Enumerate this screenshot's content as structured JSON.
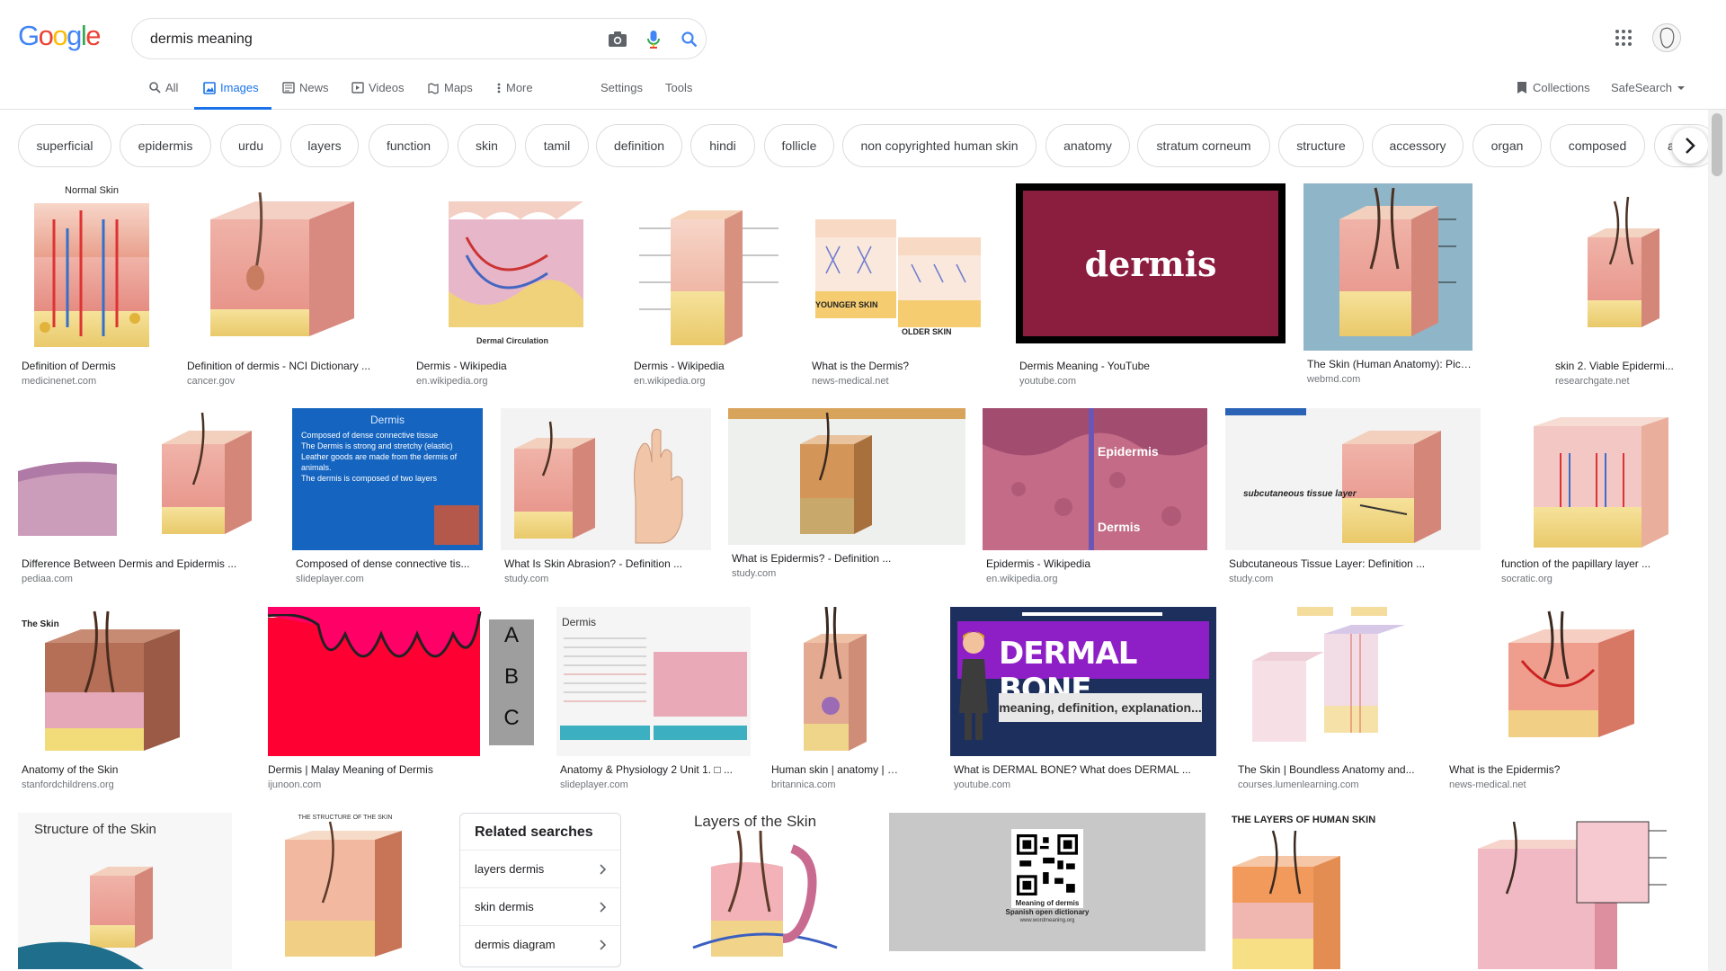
{
  "logo": "Google",
  "search": {
    "value": "dermis meaning"
  },
  "tabs": [
    {
      "label": "All"
    },
    {
      "label": "Images"
    },
    {
      "label": "News"
    },
    {
      "label": "Videos"
    },
    {
      "label": "Maps"
    },
    {
      "label": "More"
    }
  ],
  "settings_label": "Settings",
  "tools_label": "Tools",
  "collections_label": "Collections",
  "safesearch_label": "SafeSearch",
  "chips": [
    "superficial",
    "epidermis",
    "urdu",
    "layers",
    "function",
    "skin",
    "tamil",
    "definition",
    "hindi",
    "follicle",
    "non copyrighted human skin",
    "anatomy",
    "stratum corneum",
    "structure",
    "accessory",
    "organ",
    "composed",
    "a"
  ],
  "results": [
    {
      "title": "Definition of Dermis",
      "source": "medicinenet.com",
      "label": "Normal Skin"
    },
    {
      "title": "Definition of dermis - NCI Dictionary ...",
      "source": "cancer.gov"
    },
    {
      "title": "Dermis - Wikipedia",
      "source": "en.wikipedia.org",
      "label": "Dermal Circulation"
    },
    {
      "title": "Dermis - Wikipedia",
      "source": "en.wikipedia.org"
    },
    {
      "title": "What is the Dermis?",
      "source": "news-medical.net",
      "label": "YOUNGER SKIN",
      "label2": "OLDER SKIN"
    },
    {
      "title": "Dermis Meaning - YouTube",
      "source": "youtube.com",
      "label": "dermis"
    },
    {
      "title": "The Skin (Human Anatomy): Picture ...",
      "source": "webmd.com"
    },
    {
      "title": "skin 2. Viable Epidermi...",
      "source": "researchgate.net"
    },
    {
      "title": "Difference Between Dermis and Epidermis ...",
      "source": "pediaa.com"
    },
    {
      "title": "Composed of dense connective tis...",
      "source": "slideplayer.com",
      "label": "Dermis",
      "bullets": [
        "Composed of dense connective tissue",
        "The Dermis is strong and stretchy (elastic)",
        "Leather goods are made from the dermis of animals.",
        "The dermis is composed of two layers"
      ]
    },
    {
      "title": "What Is Skin Abrasion? - Definition ...",
      "source": "study.com"
    },
    {
      "title": "What is Epidermis? - Definition ...",
      "source": "study.com"
    },
    {
      "title": "Epidermis - Wikipedia",
      "source": "en.wikipedia.org",
      "label": "Epidermis",
      "label2": "Dermis"
    },
    {
      "title": "Subcutaneous Tissue Layer: Definition ...",
      "source": "study.com",
      "label": "subcutaneous tissue layer"
    },
    {
      "title": "function of the papillary layer ...",
      "source": "socratic.org"
    },
    {
      "title": "Anatomy of the Skin",
      "source": "stanfordchildrens.org",
      "label": "The Skin"
    },
    {
      "title": "Dermis | Malay Meaning of Dermis",
      "source": "ijunoon.com",
      "letters": [
        "A",
        "B",
        "C"
      ]
    },
    {
      "title": "Anatomy & Physiology 2 Unit 1. □ ...",
      "source": "slideplayer.com",
      "label": "Dermis"
    },
    {
      "title": "Human skin | anatomy | Brita...",
      "source": "britannica.com"
    },
    {
      "title": "What is DERMAL BONE? What does DERMAL ...",
      "source": "youtube.com",
      "label": "DERMAL BONE",
      "label2": "meaning, definition, explanation..."
    },
    {
      "title": "The Skin | Boundless Anatomy and...",
      "source": "courses.lumenlearning.com"
    },
    {
      "title": "What is the Epidermis?",
      "source": "news-medical.net"
    },
    {
      "label": "Structure of the Skin"
    },
    {
      "label": "THE STRUCTURE OF THE SKIN"
    },
    {
      "label": "Layers of the Skin"
    },
    {
      "label": "Meaning of dermis",
      "label2": "Spanish open dictionary",
      "label3": "www.wordmeaning.org"
    },
    {
      "label": "THE LAYERS OF HUMAN SKIN"
    },
    {
      "label": ""
    }
  ],
  "related": {
    "title": "Related searches",
    "items": [
      "layers dermis",
      "skin dermis",
      "dermis diagram"
    ]
  },
  "colors": {
    "accent": "#1a73e8",
    "youtube_dermis": "#8b1d3f",
    "dermal_bone": "#8e1fc6",
    "ijunoon_red": "#ff0033"
  }
}
